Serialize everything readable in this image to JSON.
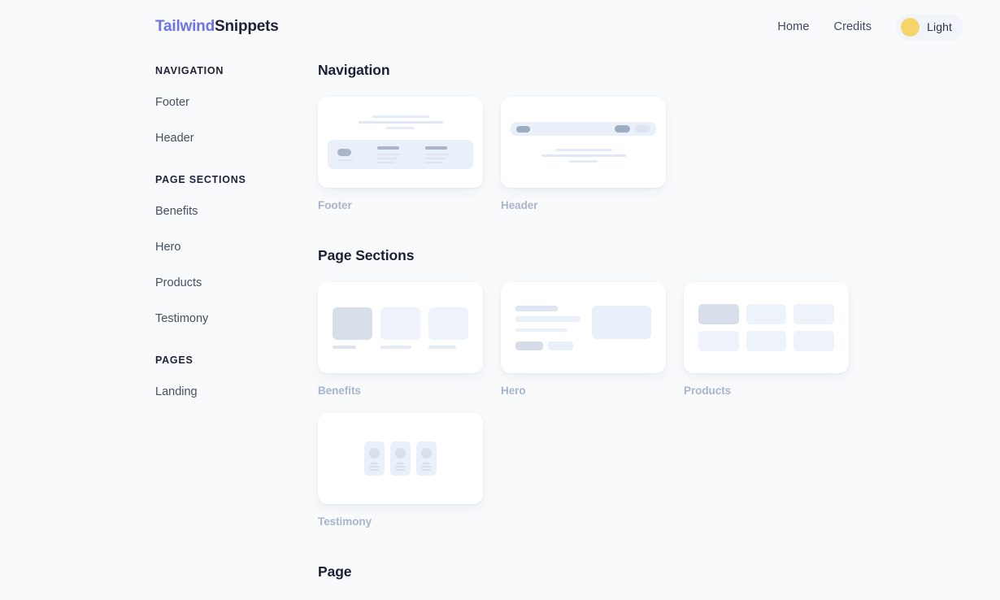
{
  "header": {
    "brand_primary": "Tailwind",
    "brand_secondary": "Snippets",
    "nav": [
      {
        "label": "Home"
      },
      {
        "label": "Credits"
      }
    ],
    "theme_toggle": {
      "label": "Light",
      "icon": "sun-icon",
      "circle_color": "#f5d46c",
      "pill_color": "#f1f5f9"
    }
  },
  "sidebar": {
    "groups": [
      {
        "title": "NAVIGATION",
        "items": [
          {
            "label": "Footer"
          },
          {
            "label": "Header"
          }
        ]
      },
      {
        "title": "PAGE SECTIONS",
        "items": [
          {
            "label": "Benefits"
          },
          {
            "label": "Hero"
          },
          {
            "label": "Products"
          },
          {
            "label": "Testimony"
          }
        ]
      },
      {
        "title": "PAGES",
        "items": [
          {
            "label": "Landing"
          }
        ]
      }
    ]
  },
  "main": {
    "sections": [
      {
        "title": "Navigation",
        "cards": [
          {
            "caption": "Footer"
          },
          {
            "caption": "Header"
          }
        ]
      },
      {
        "title": "Page Sections",
        "cards": [
          {
            "caption": "Benefits"
          },
          {
            "caption": "Hero"
          },
          {
            "caption": "Products"
          },
          {
            "caption": "Testimony"
          }
        ]
      },
      {
        "title": "Page",
        "cards": []
      }
    ]
  },
  "theme": {
    "background": "#f8fafc",
    "card": "#ffffff",
    "brand_accent": "#6f72e8",
    "heading": "#1e2235",
    "caption": "#aab5cb",
    "sun": "#f5d46c"
  }
}
